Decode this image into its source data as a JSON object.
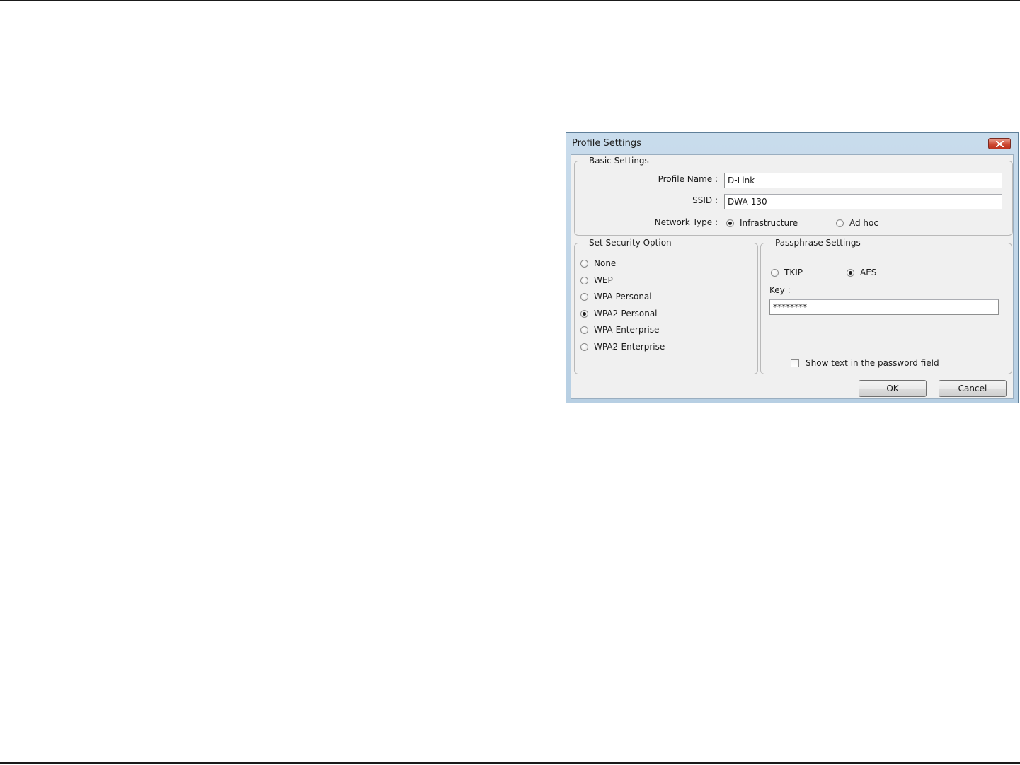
{
  "dialog": {
    "title": "Profile Settings",
    "close_icon": "close-icon"
  },
  "basic_settings": {
    "legend": "Basic Settings",
    "profile_name_label": "Profile Name :",
    "profile_name_value": "D-Link",
    "ssid_label": "SSID :",
    "ssid_value": "DWA-130",
    "network_type_label": "Network Type :",
    "network_types": [
      {
        "label": "Infrastructure",
        "selected": true
      },
      {
        "label": "Ad hoc",
        "selected": false
      }
    ]
  },
  "security": {
    "legend": "Set Security Option",
    "options": [
      {
        "label": "None",
        "selected": false
      },
      {
        "label": "WEP",
        "selected": false
      },
      {
        "label": "WPA-Personal",
        "selected": false
      },
      {
        "label": "WPA2-Personal",
        "selected": true
      },
      {
        "label": "WPA-Enterprise",
        "selected": false
      },
      {
        "label": "WPA2-Enterprise",
        "selected": false
      }
    ]
  },
  "passphrase": {
    "legend": "Passphrase Settings",
    "ciphers": [
      {
        "label": "TKIP",
        "selected": false
      },
      {
        "label": "AES",
        "selected": true
      }
    ],
    "key_label": "Key :",
    "key_value": "********",
    "show_text_label": "Show text in the password field",
    "show_text_checked": false
  },
  "buttons": {
    "ok_label": "OK",
    "cancel_label": "Cancel"
  }
}
